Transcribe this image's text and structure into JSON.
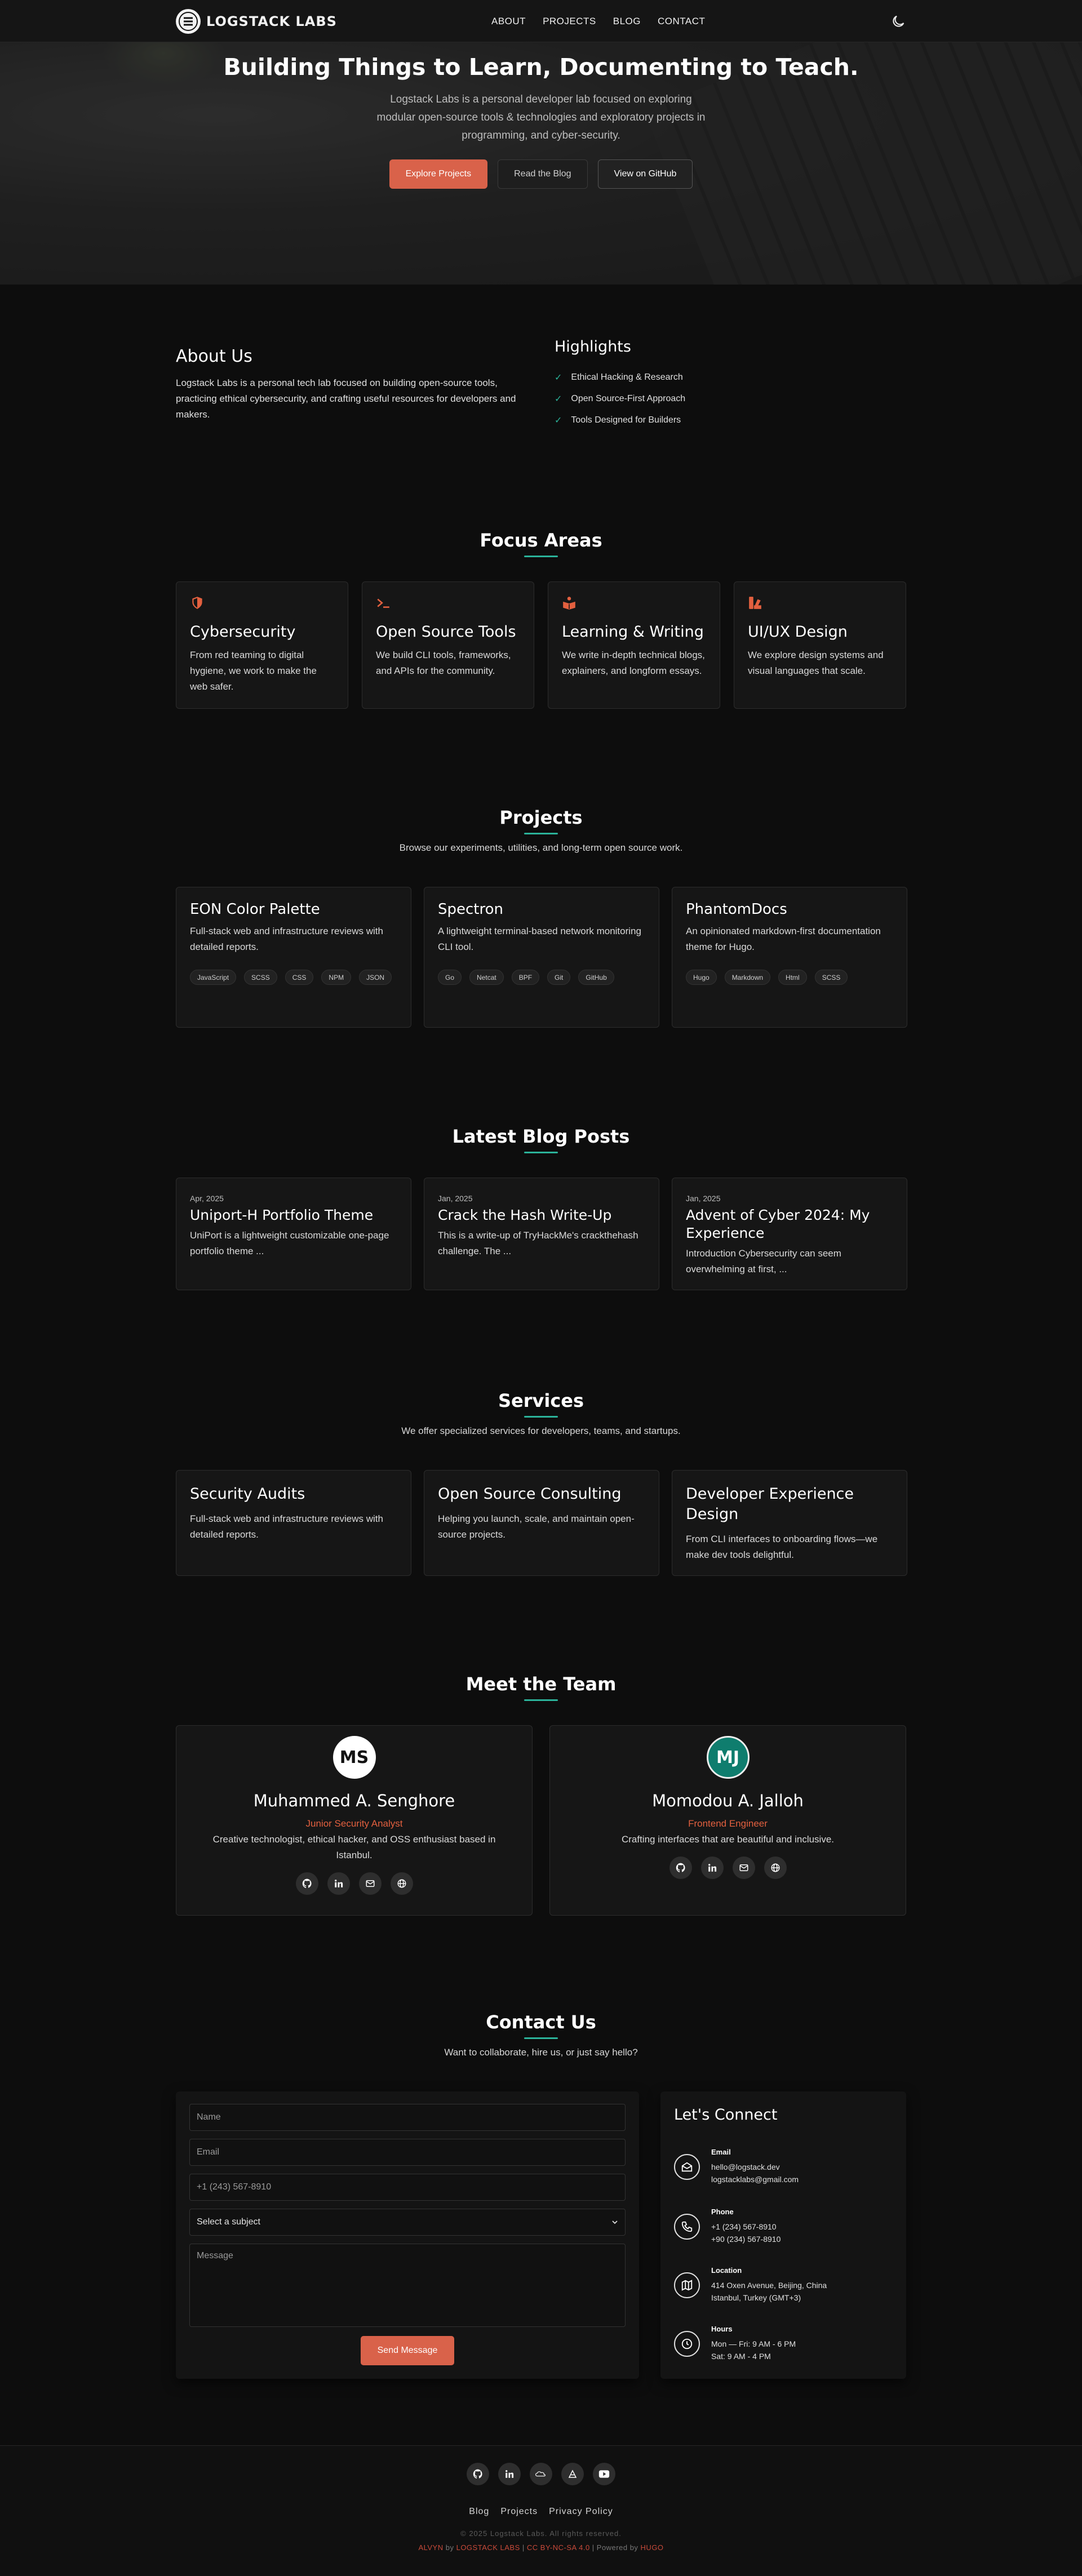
{
  "brand": {
    "logo_text": "LOGSTACK LABS",
    "accent": "#d9624a",
    "teal": "#2bb39a"
  },
  "nav": {
    "items": [
      {
        "label": "ABOUT"
      },
      {
        "label": "PROJECTS"
      },
      {
        "label": "BLOG"
      },
      {
        "label": "CONTACT"
      }
    ],
    "theme_toggle_icon": "moon-icon"
  },
  "hero": {
    "title": "Building Things to Learn, Documenting to Teach.",
    "subtitle": "Logstack Labs is a personal developer lab focused on exploring modular open-source tools & technologies and exploratory projects in programming, and cyber-security.",
    "buttons": {
      "explore": "Explore Projects",
      "blog": "Read the Blog",
      "github": "View on GitHub"
    }
  },
  "about": {
    "title": "About Us",
    "text": "Logstack Labs is a personal tech lab focused on building open-source tools, practicing ethical cybersecurity, and crafting useful resources for developers and makers.",
    "highlights_title": "Highlights",
    "highlights": [
      "Ethical Hacking & Research",
      "Open Source-First Approach",
      "Tools Designed for Builders"
    ]
  },
  "focus": {
    "title": "Focus Areas",
    "items": [
      {
        "title": "Cybersecurity",
        "text": "From red teaming to digital hygiene, we work to make the web safer.",
        "icon": "shield-icon"
      },
      {
        "title": "Open Source Tools",
        "text": "We build CLI tools, frameworks, and APIs for the community.",
        "icon": "terminal-icon"
      },
      {
        "title": "Learning & Writing",
        "text": "We write in-depth technical blogs, explainers, and longform essays.",
        "icon": "book-icon"
      },
      {
        "title": "UI/UX Design",
        "text": "We explore design systems and visual languages that scale.",
        "icon": "palette-icon"
      }
    ]
  },
  "projects": {
    "title": "Projects",
    "subtitle": "Browse our experiments, utilities, and long-term open source work.",
    "items": [
      {
        "title": "EON Color Palette",
        "text": "Full-stack web and infrastructure reviews with detailed reports.",
        "tags": [
          "JavaScript",
          "SCSS",
          "CSS",
          "NPM",
          "JSON"
        ]
      },
      {
        "title": "Spectron",
        "text": "A lightweight terminal-based network monitoring CLI tool.",
        "tags": [
          "Go",
          "Netcat",
          "BPF",
          "Git",
          "GitHub"
        ]
      },
      {
        "title": "PhantomDocs",
        "text": "An opinionated markdown-first documentation theme for Hugo.",
        "tags": [
          "Hugo",
          "Markdown",
          "Html",
          "SCSS"
        ]
      }
    ]
  },
  "blog": {
    "title": "Latest Blog Posts",
    "items": [
      {
        "date": "Apr, 2025",
        "title": "Uniport-H Portfolio Theme",
        "text": "UniPort is a lightweight customizable one-page portfolio theme ..."
      },
      {
        "date": "Jan, 2025",
        "title": "Crack the Hash Write-Up",
        "text": "This is a write-up of TryHackMe's crackthehash challenge. The ..."
      },
      {
        "date": "Jan, 2025",
        "title": "Advent of Cyber 2024: My Experience",
        "text": "Introduction Cybersecurity can seem overwhelming at first, ..."
      }
    ]
  },
  "services": {
    "title": "Services",
    "subtitle": "We offer specialized services for developers, teams, and startups.",
    "items": [
      {
        "title": "Security Audits",
        "text": "Full-stack web and infrastructure reviews with detailed reports."
      },
      {
        "title": "Open Source Consulting",
        "text": "Helping you launch, scale, and maintain open-source projects."
      },
      {
        "title": "Developer Experience Design",
        "text": "From CLI interfaces to onboarding flows—we make dev tools delightful."
      }
    ]
  },
  "team": {
    "title": "Meet the Team",
    "members": [
      {
        "initials": "MS",
        "name": "Muhammed A. Senghore",
        "role": "Junior Security Analyst",
        "bio": "Creative technologist, ethical hacker, and OSS enthusiast based in Istanbul.",
        "avatar_bg": "#ffffff",
        "avatar_fg": "#111111"
      },
      {
        "initials": "MJ",
        "name": "Momodou A. Jalloh",
        "role": "Frontend Engineer",
        "bio": "Crafting interfaces that are beautiful and inclusive.",
        "avatar_bg": "#0f7d6e",
        "avatar_fg": "#ffffff"
      }
    ]
  },
  "contact": {
    "title": "Contact Us",
    "subtitle": "Want to collaborate, hire us, or just say hello?",
    "form": {
      "name_placeholder": "Name",
      "email_placeholder": "Email",
      "phone_placeholder": "+1 (243) 567-8910",
      "subject_value": "Select a subject",
      "message_placeholder": "Message",
      "send_label": "Send Message"
    },
    "info": {
      "title": "Let's Connect",
      "email": {
        "label": "Email",
        "lines": [
          "hello@logstack.dev",
          "logstacklabs@gmail.com"
        ]
      },
      "phone": {
        "label": "Phone",
        "lines": [
          "+1 (234) 567-8910",
          "+90 (234) 567-8910"
        ]
      },
      "location": {
        "label": "Location",
        "lines": [
          "414 Oxen Avenue, Beijing, China",
          "Istanbul, Turkey (GMT+3)"
        ]
      },
      "hours": {
        "label": "Hours",
        "lines": [
          "Mon — Fri: 9 AM - 6 PM",
          "Sat: 9 AM - 4 PM"
        ]
      }
    }
  },
  "footer": {
    "links": [
      "Blog",
      "Projects",
      "Privacy Policy"
    ],
    "copyright": "© 2025 Logstack Labs. All rights reserved.",
    "credit_a": "ALVYN",
    "credit_by": " by ",
    "credit_b": "LOGSTACK LABS",
    "credit_sep": " | ",
    "credit_c": "CC BY-NC-SA 4.0",
    "credit_sep2": " | Powered by ",
    "credit_d": "HUGO"
  }
}
